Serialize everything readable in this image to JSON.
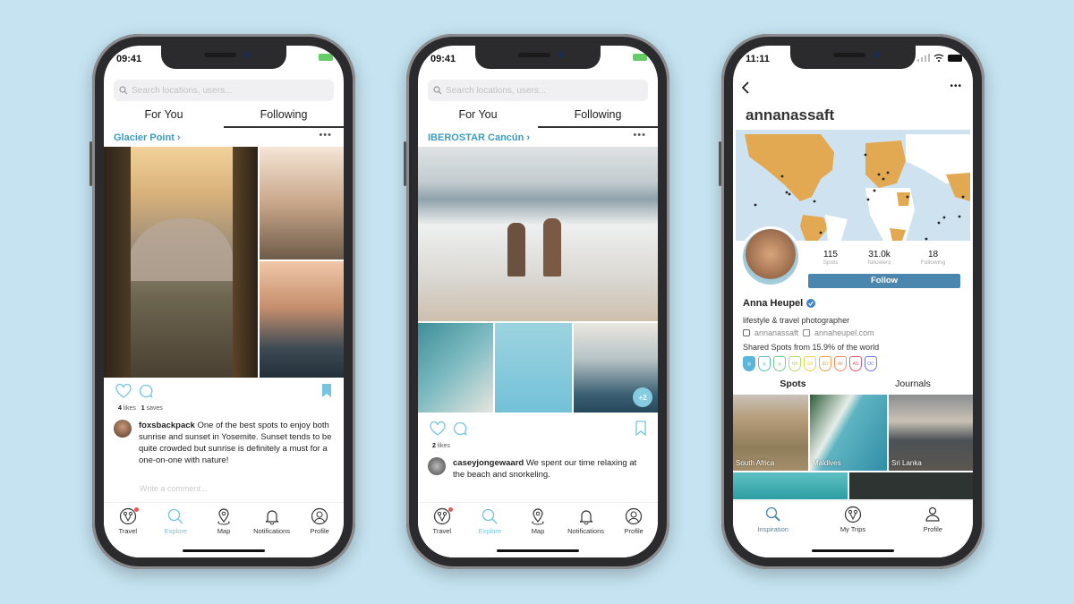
{
  "phones": [
    {
      "status": {
        "time": "09:41"
      },
      "search": {
        "placeholder": "Search locations, users..."
      },
      "tabs": [
        {
          "label": "For You",
          "active": false
        },
        {
          "label": "Following",
          "active": true
        }
      ],
      "post": {
        "location": "Glacier Point",
        "more_label": "•••",
        "likes_count": "4",
        "likes_label": "likes",
        "saves_count": "1",
        "saves_label": "saves",
        "saved": true,
        "author": "foxsbackpack",
        "caption": "One of the best spots to enjoy both sunrise and sunset in Yosemite. Sunset tends to be quite crowded but sunrise is definitely a must for a one-on-one with nature!",
        "comment_placeholder": "Write a comment..."
      },
      "tabbar": [
        {
          "label": "Travel",
          "icon": "travel-icon",
          "active": false,
          "notification": true
        },
        {
          "label": "Explore",
          "icon": "search-icon",
          "active": true
        },
        {
          "label": "Map",
          "icon": "map-pin-icon",
          "active": false
        },
        {
          "label": "Notifications",
          "icon": "bell-icon",
          "active": false
        },
        {
          "label": "Profile",
          "icon": "profile-icon",
          "active": false
        }
      ]
    },
    {
      "status": {
        "time": "09:41"
      },
      "search": {
        "placeholder": "Search locations, users..."
      },
      "tabs": [
        {
          "label": "For You",
          "active": false
        },
        {
          "label": "Following",
          "active": true
        }
      ],
      "post": {
        "location": "IBEROSTAR Cancún",
        "more_label": "•••",
        "extra_photos": "+2",
        "likes_count": "2",
        "likes_label": "likes",
        "saved": false,
        "author": "caseyjongewaard",
        "caption": "We spent our time relaxing at the beach and snorkeling."
      },
      "tabbar": [
        {
          "label": "Travel",
          "icon": "travel-icon",
          "active": false,
          "notification": true
        },
        {
          "label": "Explore",
          "icon": "search-icon",
          "active": true
        },
        {
          "label": "Map",
          "icon": "map-pin-icon",
          "active": false
        },
        {
          "label": "Notifications",
          "icon": "bell-icon",
          "active": false
        },
        {
          "label": "Profile",
          "icon": "profile-icon",
          "active": false
        }
      ]
    },
    {
      "status": {
        "time": "11:11"
      },
      "profile": {
        "username": "annanassaft",
        "more_label": "•••",
        "stats": [
          {
            "value": "115",
            "label": "Spots"
          },
          {
            "value": "31.0k",
            "label": "followers"
          },
          {
            "value": "18",
            "label": "Following"
          }
        ],
        "follow_label": "Follow",
        "name": "Anna Heupel",
        "verified": true,
        "bio": "lifestyle & travel photographer",
        "instagram": "annanassaft",
        "website": "annaheupel.com",
        "shared_text": "Shared Spots from 15.9% of the world",
        "badges": [
          {
            "label": "",
            "color": "#5bb6d9",
            "filled": true,
            "icon": "travel-badge-icon"
          },
          {
            "label": "",
            "color": "#5fc2b4",
            "filled": false,
            "icon": "compass-badge-icon"
          },
          {
            "label": "",
            "color": "#7cc98a",
            "filled": false,
            "icon": "bookmark-badge-icon"
          },
          {
            "label": "NA",
            "color": "#b7d86a",
            "filled": false
          },
          {
            "label": "SA",
            "color": "#f0cf4c",
            "filled": false
          },
          {
            "label": "EU",
            "color": "#f0a04b",
            "filled": false
          },
          {
            "label": "AF",
            "color": "#ef8a6a",
            "filled": false
          },
          {
            "label": "AS",
            "color": "#e55467",
            "filled": false
          },
          {
            "label": "OC",
            "color": "#6f75e2",
            "filled": false
          }
        ],
        "content_tabs": [
          {
            "label": "Spots",
            "active": true
          },
          {
            "label": "Journals",
            "active": false
          }
        ],
        "spots": [
          "South Africa",
          "Maldives",
          "Sri Lanka"
        ]
      },
      "tabbar": [
        {
          "label": "Inspiration",
          "icon": "search-icon",
          "active": true
        },
        {
          "label": "My Trips",
          "icon": "travel-icon",
          "active": false
        },
        {
          "label": "Profile",
          "icon": "profile-icon",
          "active": false
        }
      ]
    }
  ],
  "colors": {
    "accent": "#3d9bbb",
    "active_tab": "#77c4e0",
    "follow": "#4a86ad",
    "map_land": "#e3a852",
    "map_water": "#cfe2f0"
  }
}
